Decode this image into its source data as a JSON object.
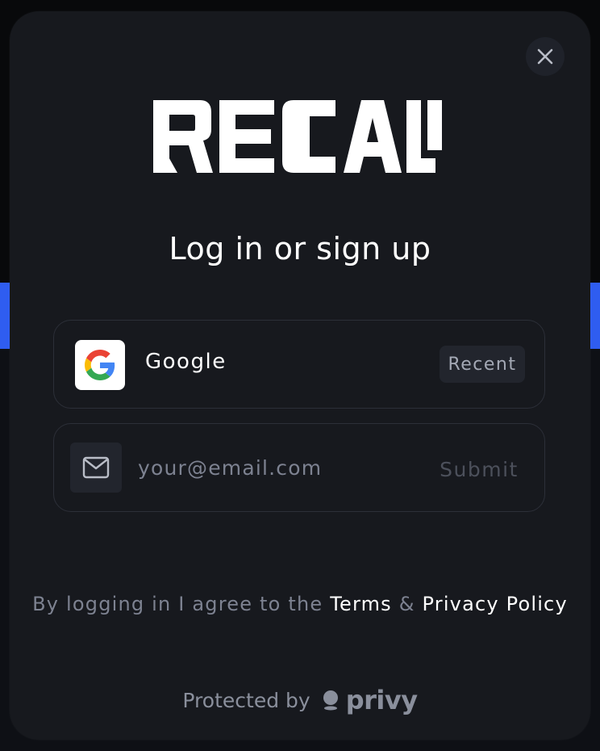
{
  "modal": {
    "logo_text": "RECALL",
    "heading": "Log in or sign up",
    "close_icon": "close-icon"
  },
  "google_login": {
    "icon": "google-icon",
    "label": "Google",
    "badge": "Recent"
  },
  "email_login": {
    "icon": "mail-icon",
    "value": "",
    "placeholder": "your@email.com",
    "submit_label": "Submit"
  },
  "legal": {
    "prefix": "By logging in I agree to the",
    "terms_label": "Terms",
    "ampersand": "&",
    "privacy_label": "Privacy Policy"
  },
  "footer": {
    "prefix": "Protected by",
    "brand_icon": "privy-icon",
    "brand": "privy"
  },
  "colors": {
    "modal_bg": "#17191e",
    "border": "#2c2f38",
    "muted_text": "#7d8291",
    "background_accent": "#2f5df0"
  }
}
